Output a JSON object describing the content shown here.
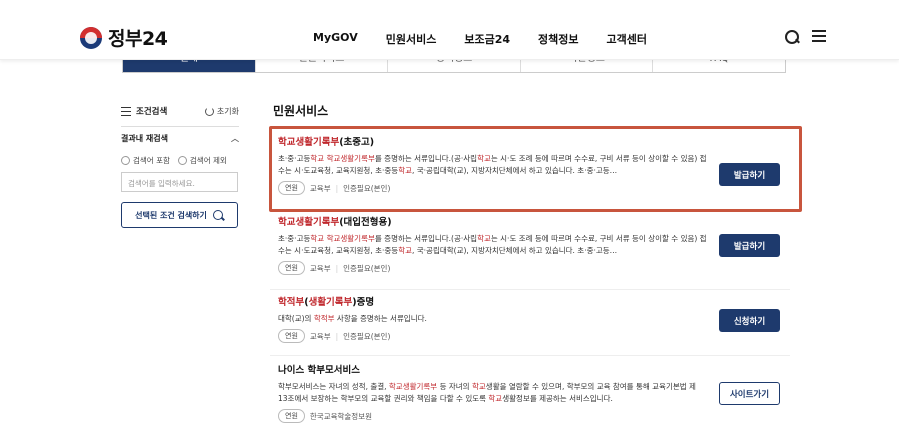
{
  "header": {
    "logo_text": "정부24",
    "nav": [
      "MyGOV",
      "민원서비스",
      "보조금24",
      "정책정보",
      "고객센터"
    ]
  },
  "tabs": [
    "전체",
    "민원서비스",
    "정책정보",
    "기관정보",
    "FAQ"
  ],
  "sidebar": {
    "filter_title": "조건검색",
    "reset_label": "초기화",
    "subsearch_title": "결과내 재검색",
    "radio_include": "검색어 포함",
    "radio_exclude": "검색어 제외",
    "input_placeholder": "검색어를 입력하세요.",
    "search_button": "선택된 조건 검색하기"
  },
  "main": {
    "section_title": "민원서비스",
    "items": [
      {
        "title_hl": "학교생활기록부",
        "title_rest": "(초중고)",
        "desc": [
          {
            "t": "초·중·고등"
          },
          {
            "t": "학교",
            "hl": true
          },
          {
            "t": " "
          },
          {
            "t": "학교생활기록부",
            "hl": true
          },
          {
            "t": "를 증명하는 서류입니다.(공·사립"
          },
          {
            "t": "학교",
            "hl": true
          },
          {
            "t": "는 시·도 조례 등에 따르며 수수료, 구비 서류 등이 상이할 수 있음) 접수는 시·도교육청, 교육지원청, 초·중등"
          },
          {
            "t": "학교",
            "hl": true
          },
          {
            "t": ", 국·공립대학(교), 지방자치단체에서 하고 있습니다. 초·중·고등…"
          }
        ],
        "badge": "연원",
        "org": "교육부",
        "auth": "인증필요(본인)",
        "button": "발급하기"
      },
      {
        "title_hl": "학교생활기록부",
        "title_rest": "(대입전형용)",
        "desc": [
          {
            "t": "초·중·고등"
          },
          {
            "t": "학교",
            "hl": true
          },
          {
            "t": " "
          },
          {
            "t": "학교생활기록부",
            "hl": true
          },
          {
            "t": "를 증명하는 서류입니다.(공·사립"
          },
          {
            "t": "학교",
            "hl": true
          },
          {
            "t": "는 시·도 조례 등에 따르며 수수료, 구비 서류 등이 상이할 수 있음) 접수는 시·도교육청, 교육지원청, 초·중등"
          },
          {
            "t": "학교",
            "hl": true
          },
          {
            "t": ", 국·공립대학(교), 지방자치단체에서 하고 있습니다. 초·중·고등…"
          }
        ],
        "badge": "연원",
        "org": "교육부",
        "auth": "인증필요(본인)",
        "button": "발급하기"
      },
      {
        "title_hl": "학적부",
        "title_mid": "(",
        "title_hl2": "생활기록부",
        "title_rest": ")증명",
        "desc": [
          {
            "t": "대학(교)의 "
          },
          {
            "t": "학적부",
            "hl": true
          },
          {
            "t": " 사항을 증명하는 서류입니다."
          }
        ],
        "badge": "연원",
        "org": "교육부",
        "auth": "인증필요(본인)",
        "button": "신청하기"
      },
      {
        "title_plain": "나이스 학부모서비스",
        "desc": [
          {
            "t": "학부모서비스는 자녀의 성적, 출결, "
          },
          {
            "t": "학교생활기록부",
            "hl": true
          },
          {
            "t": " 등 자녀의 "
          },
          {
            "t": "학교",
            "hl": true
          },
          {
            "t": "생활을 열람할 수 있으며, 학부모의 교육 참여를 통해 교육기본법 제13조에서 보장하는 학부모의 교육할 권리와 책임을 다할 수 있도록 "
          },
          {
            "t": "학교",
            "hl": true
          },
          {
            "t": "생활정보를 제공하는 서비스입니다."
          }
        ],
        "badge": "연원",
        "org": "한국교육학술정보원",
        "button": "사이트가기"
      }
    ]
  }
}
